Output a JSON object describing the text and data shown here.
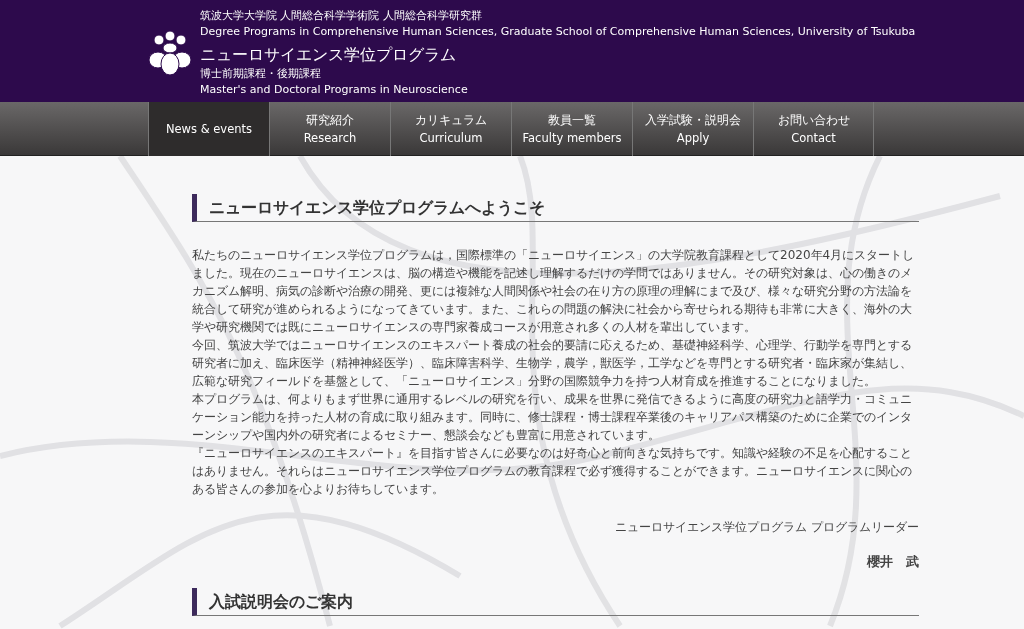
{
  "header": {
    "org_ja": "筑波大学大学院 人間総合科学学術院 人間総合科学研究群",
    "org_en": "Degree Programs in Comprehensive Human Sciences, Graduate School of Comprehensive Human Sciences, University of Tsukuba",
    "title": "ニューロサイエンス学位プログラム",
    "subtitle_ja": "博士前期課程・後期課程",
    "subtitle_en": "Master's and Doctoral Programs in Neuroscience"
  },
  "nav": [
    {
      "en": "News & events",
      "selected": true
    },
    {
      "ja": "研究紹介",
      "en": "Research",
      "selected": false
    },
    {
      "ja": "カリキュラム",
      "en": "Curriculum",
      "selected": false
    },
    {
      "ja": "教員一覧",
      "en": "Faculty members",
      "selected": false
    },
    {
      "ja": "入学試験・説明会",
      "en": "Apply",
      "selected": false
    },
    {
      "ja": "お問い合わせ",
      "en": "Contact",
      "selected": false
    }
  ],
  "welcome": {
    "heading": "ニューロサイエンス学位プログラムへようこそ",
    "paragraphs": [
      "私たちのニューロサイエンス学位プログラムは，国際標準の「ニューロサイエンス」の大学院教育課程として2020年4月にスタートしました。現在のニューロサイエンスは、脳の構造や機能を記述し理解するだけの学問ではありません。その研究対象は、心の働きのメカニズム解明、病気の診断や治療の開発、更には複雑な人間関係や社会の在り方の原理の理解にまで及び、様々な研究分野の方法論を統合して研究が進められるようになってきています。また、これらの問題の解決に社会から寄せられる期待も非常に大きく、海外の大学や研究機関では既にニューロサイエンスの専門家養成コースが用意され多くの人材を輩出しています。",
      "今回、筑波大学ではニューロサイエンスのエキスパート養成の社会的要請に応えるため、基礎神経科学、心理学、行動学を専門とする研究者に加え、臨床医学（精神神経医学）、臨床障害科学、生物学，農学，獣医学，工学などを専門とする研究者・臨床家が集結し、広範な研究フィールドを基盤として、「ニューロサイエンス」分野の国際競争力を持つ人材育成を推進することになりました。",
      "本プログラムは、何よりもまず世界に通用するレベルの研究を行い、成果を世界に発信できるように高度の研究力と語学力・コミュニケーション能力を持った人材の育成に取り組みます。同時に、修士課程・博士課程卒業後のキャリアパス構築のために企業でのインターンシップや国内外の研究者によるセミナー、懇談会なども豊富に用意されています。",
      "『ニューロサイエンスのエキスパート』を目指す皆さんに必要なのは好奇心と前向きな気持ちです。知識や経験の不足を心配することはありません。それらはニューロサイエンス学位プログラムの教育課程で必ず獲得することができます。ニューロサイエンスに関心のある皆さんの参加を心よりお待ちしています。"
    ],
    "signature_role": "ニューロサイエンス学位プログラム プログラムリーダー",
    "signature_name": "櫻井　武"
  },
  "admissions": {
    "heading": "入試説明会のご案内"
  }
}
